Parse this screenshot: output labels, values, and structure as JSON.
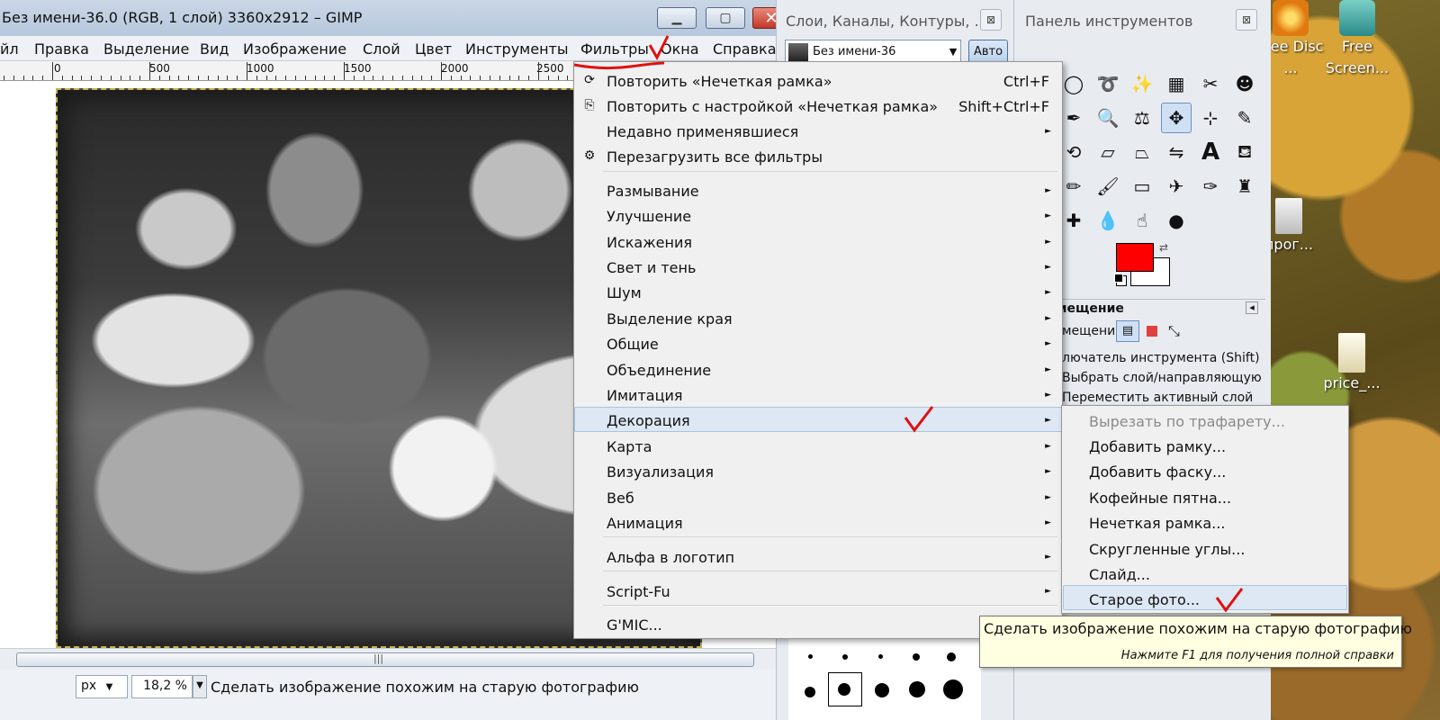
{
  "window": {
    "title": "Без имени-36.0 (RGB, 1 слой) 3360x2912 – GIMP",
    "min": "▁",
    "max": "▢",
    "close": "✕"
  },
  "menubar": [
    "йл",
    "Правка",
    "Выделение",
    "Вид",
    "Изображение",
    "Слой",
    "Цвет",
    "Инструменты",
    "Фильтры",
    "Окна",
    "Справка"
  ],
  "ruler": [
    "0",
    "500",
    "1000",
    "1500",
    "2000",
    "2500"
  ],
  "status": {
    "unit": "px",
    "zoom": "18,2 %",
    "message": "Сделать изображение похожим на старую фотографию"
  },
  "layers_dock": {
    "title": "Слои, Каналы, Контуры, ...",
    "image_name": "Без имени-36",
    "auto_button": "Авто"
  },
  "toolbox": {
    "title": "Панель инструментов",
    "fg_color": "#ff0000",
    "bg_color": "#ffffff",
    "options_title": "мещение",
    "options_mode_label": "мещение:",
    "options_line1": "лючатель инструмента  (Shift)",
    "options_line2": "Выбрать слой/направляющую",
    "options_line3": "Переместить активный слой"
  },
  "desktop": {
    "icons": [
      {
        "label": "Free Disc ...",
        "icon": "disc-icon"
      },
      {
        "label": "Free Screen...",
        "icon": "screen-recorder-icon"
      },
      {
        "label": "прог...",
        "icon": "folder-icon"
      },
      {
        "label": "price_...",
        "icon": "document-icon"
      }
    ]
  },
  "filters_menu": {
    "items": [
      {
        "label": "Повторить «Нечеткая рамка»",
        "shortcut": "Ctrl+F",
        "icon": "repeat-icon"
      },
      {
        "label": "Повторить с настройкой «Нечеткая рамка»",
        "shortcut": "Shift+Ctrl+F",
        "icon": "reshow-icon"
      },
      {
        "label": "Недавно применявшиеся",
        "submenu": true
      },
      {
        "label": "Перезагрузить все фильтры",
        "icon": "reload-icon"
      },
      {
        "label": "Размывание",
        "submenu": true
      },
      {
        "label": "Улучшение",
        "submenu": true
      },
      {
        "label": "Искажения",
        "submenu": true
      },
      {
        "label": "Свет и тень",
        "submenu": true
      },
      {
        "label": "Шум",
        "submenu": true
      },
      {
        "label": "Выделение края",
        "submenu": true
      },
      {
        "label": "Общие",
        "submenu": true
      },
      {
        "label": "Объединение",
        "submenu": true
      },
      {
        "label": "Имитация",
        "submenu": true
      },
      {
        "label": "Декорация",
        "submenu": true,
        "active": true
      },
      {
        "label": "Карта",
        "submenu": true
      },
      {
        "label": "Визуализация",
        "submenu": true
      },
      {
        "label": "Веб",
        "submenu": true
      },
      {
        "label": "Анимация",
        "submenu": true
      },
      {
        "label": "Альфа в логотип",
        "submenu": true
      },
      {
        "label": "Script-Fu",
        "submenu": true
      },
      {
        "label": "G'MIC..."
      }
    ]
  },
  "decoration_menu": {
    "items": [
      {
        "label": "Вырезать по трафарету...",
        "disabled": true
      },
      {
        "label": "Добавить рамку..."
      },
      {
        "label": "Добавить фаску..."
      },
      {
        "label": "Кофейные пятна..."
      },
      {
        "label": "Нечеткая рамка..."
      },
      {
        "label": "Скругленные углы..."
      },
      {
        "label": "Слайд..."
      },
      {
        "label": "Старое фото...",
        "active": true
      }
    ]
  },
  "tooltip": {
    "text": "Сделать изображение похожим на старую фотографию",
    "help": "Нажмите F1 для получения полной справки"
  },
  "arrow_glyph": "►",
  "scroll_grip": "|||",
  "combo_arrow": "▼",
  "dock_close": "⊠"
}
